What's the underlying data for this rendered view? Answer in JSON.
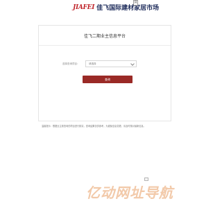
{
  "header": {
    "logo_mark": "JIAFEI",
    "logo_text": "佳飞国际建材家居市场",
    "logo_badge": "R"
  },
  "card": {
    "title": "佳飞二期业主信息平台",
    "form": {
      "label": "选择查询项目：",
      "select_value": "请选择"
    },
    "query_button": "查询"
  },
  "notice": "温馨提示：根据业主需查询的项目进行核实，查询结果仅供参考，为避免信息变更，请及时核对最新信息。",
  "watermark": "亿动网址导航",
  "icons": {
    "dropdown": "chevron-down-icon",
    "image_placeholder": "broken-image-icon"
  }
}
